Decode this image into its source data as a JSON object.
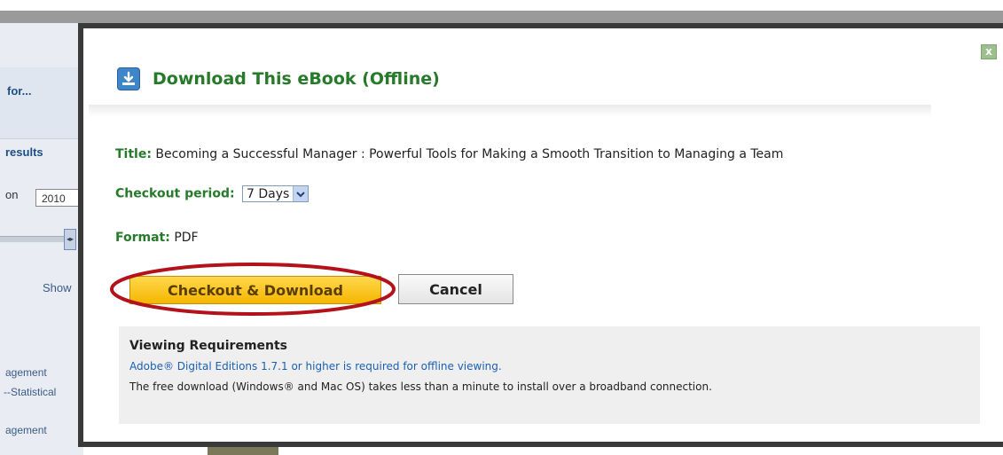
{
  "background": {
    "search_heading": "for...",
    "results_link": "results",
    "pub_label": "on",
    "year_value": "2010",
    "show_link": "Show",
    "subjects": [
      "agement",
      "--Statistical",
      "agement"
    ]
  },
  "modal": {
    "close_label": "x",
    "title": "Download This eBook (Offline)",
    "book_title_label": "Title:",
    "book_title_value": "Becoming a Successful Manager : Powerful Tools for Making a Smooth Transition to Managing a Team",
    "checkout_period_label": "Checkout period:",
    "checkout_period_value": "7 Days",
    "format_label": "Format:",
    "format_value": "PDF",
    "checkout_button": "Checkout & Download",
    "cancel_button": "Cancel",
    "requirements": {
      "heading": "Viewing Requirements",
      "link": "Adobe® Digital Editions 1.7.1 or higher is required for offline viewing.",
      "note": "The free download (Windows® and Mac OS) takes less than a minute to install over a broadband connection."
    }
  },
  "colors": {
    "title_green": "#267a2a",
    "checkout_yellow": "#f5b600",
    "highlight_red": "#b3121b",
    "link_blue": "#1a5fb4"
  },
  "icons": [
    "download-icon",
    "close-icon",
    "chevron-down-icon"
  ]
}
